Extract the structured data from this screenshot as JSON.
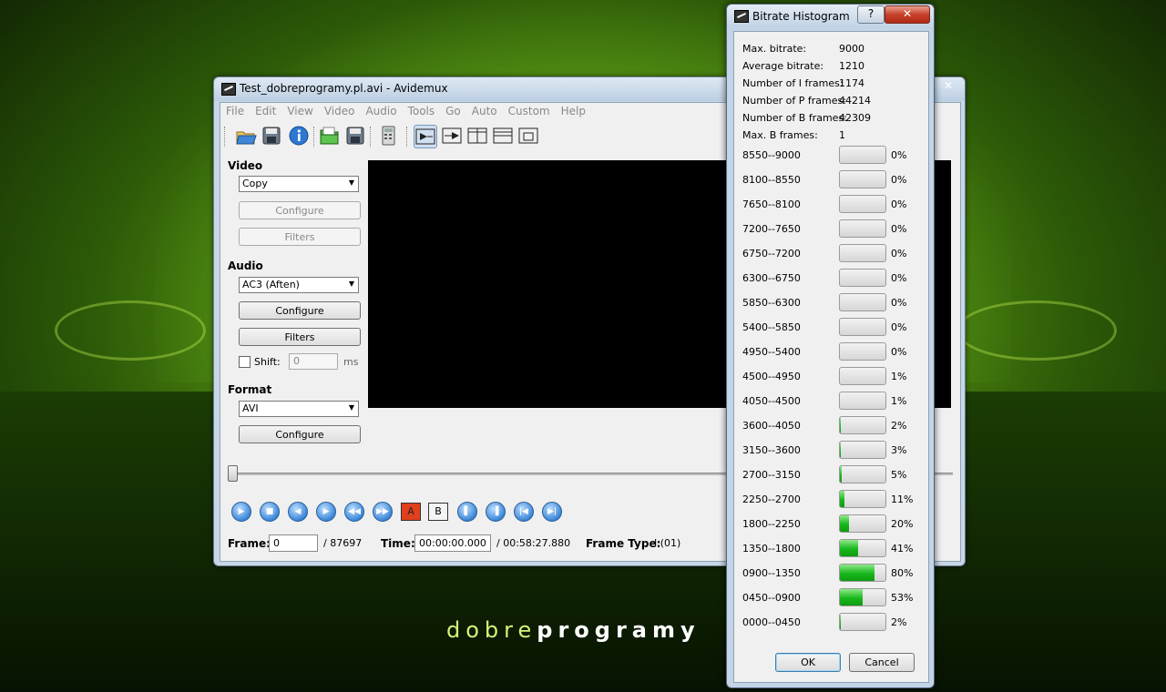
{
  "brand": {
    "thin": "dobre",
    "bold": "programy"
  },
  "main_window": {
    "title": "Test_dobreprogramy.pl.avi - Avidemux",
    "close": "✕",
    "menu": [
      "File",
      "Edit",
      "View",
      "Video",
      "Audio",
      "Tools",
      "Go",
      "Auto",
      "Custom",
      "Help"
    ],
    "video": {
      "label": "Video",
      "codec": "Copy",
      "configure": "Configure",
      "filters": "Filters"
    },
    "audio": {
      "label": "Audio",
      "codec": "AC3 (Aften)",
      "configure": "Configure",
      "filters": "Filters",
      "shift_label": "Shift:",
      "shift_value": "0",
      "shift_unit": "ms"
    },
    "format": {
      "label": "Format",
      "container": "AVI",
      "configure": "Configure"
    },
    "markers": {
      "a": "A",
      "b": "B"
    },
    "status": {
      "frame_label": "Frame:",
      "frame_value": "0",
      "frame_total": "/ 87697",
      "time_label": "Time:",
      "time_value": "00:00:00.000",
      "time_total": "/ 00:58:27.880",
      "frametype_label": "Frame Type:",
      "frametype_value": "I (01)"
    }
  },
  "histogram": {
    "title": "Bitrate Histogram",
    "help": "?",
    "close": "✕",
    "stats": [
      {
        "label": "Max. bitrate:",
        "value": "9000"
      },
      {
        "label": "Average bitrate:",
        "value": "1210"
      },
      {
        "label": "Number of I frames:",
        "value": "1174"
      },
      {
        "label": "Number of P frames:",
        "value": "44214"
      },
      {
        "label": "Number of B frames:",
        "value": "42309"
      },
      {
        "label": "Max. B frames:",
        "value": "1"
      }
    ],
    "rows": [
      {
        "range": "8550--9000",
        "percent": 0,
        "label": "0%"
      },
      {
        "range": "8100--8550",
        "percent": 0,
        "label": "0%"
      },
      {
        "range": "7650--8100",
        "percent": 0,
        "label": "0%"
      },
      {
        "range": "7200--7650",
        "percent": 0,
        "label": "0%"
      },
      {
        "range": "6750--7200",
        "percent": 0,
        "label": "0%"
      },
      {
        "range": "6300--6750",
        "percent": 0,
        "label": "0%"
      },
      {
        "range": "5850--6300",
        "percent": 0,
        "label": "0%"
      },
      {
        "range": "5400--5850",
        "percent": 0,
        "label": "0%"
      },
      {
        "range": "4950--5400",
        "percent": 0,
        "label": "0%"
      },
      {
        "range": "4500--4950",
        "percent": 1,
        "label": "1%"
      },
      {
        "range": "4050--4500",
        "percent": 1,
        "label": "1%"
      },
      {
        "range": "3600--4050",
        "percent": 2,
        "label": "2%"
      },
      {
        "range": "3150--3600",
        "percent": 3,
        "label": "3%"
      },
      {
        "range": "2700--3150",
        "percent": 5,
        "label": "5%"
      },
      {
        "range": "2250--2700",
        "percent": 11,
        "label": "11%"
      },
      {
        "range": "1800--2250",
        "percent": 20,
        "label": "20%"
      },
      {
        "range": "1350--1800",
        "percent": 41,
        "label": "41%"
      },
      {
        "range": "0900--1350",
        "percent": 80,
        "label": "80%"
      },
      {
        "range": "0450--0900",
        "percent": 53,
        "label": "53%"
      },
      {
        "range": "0000--0450",
        "percent": 2,
        "label": "2%"
      }
    ],
    "ok": "OK",
    "cancel": "Cancel"
  }
}
